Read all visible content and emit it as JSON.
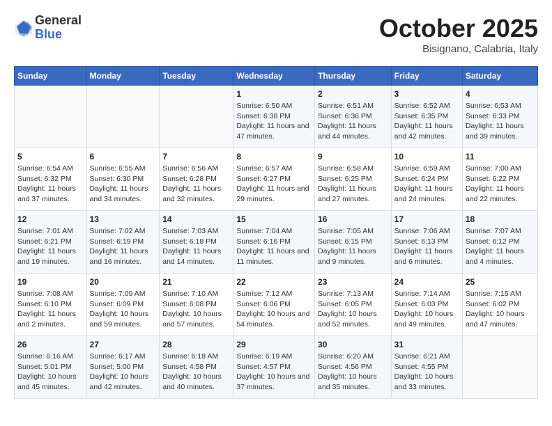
{
  "header": {
    "logo_general": "General",
    "logo_blue": "Blue",
    "month_title": "October 2025",
    "subtitle": "Bisignano, Calabria, Italy"
  },
  "calendar": {
    "days_of_week": [
      "Sunday",
      "Monday",
      "Tuesday",
      "Wednesday",
      "Thursday",
      "Friday",
      "Saturday"
    ],
    "weeks": [
      [
        {
          "day": "",
          "info": ""
        },
        {
          "day": "",
          "info": ""
        },
        {
          "day": "",
          "info": ""
        },
        {
          "day": "1",
          "info": "Sunrise: 6:50 AM\nSunset: 6:38 PM\nDaylight: 11 hours and 47 minutes."
        },
        {
          "day": "2",
          "info": "Sunrise: 6:51 AM\nSunset: 6:36 PM\nDaylight: 11 hours and 44 minutes."
        },
        {
          "day": "3",
          "info": "Sunrise: 6:52 AM\nSunset: 6:35 PM\nDaylight: 11 hours and 42 minutes."
        },
        {
          "day": "4",
          "info": "Sunrise: 6:53 AM\nSunset: 6:33 PM\nDaylight: 11 hours and 39 minutes."
        }
      ],
      [
        {
          "day": "5",
          "info": "Sunrise: 6:54 AM\nSunset: 6:32 PM\nDaylight: 11 hours and 37 minutes."
        },
        {
          "day": "6",
          "info": "Sunrise: 6:55 AM\nSunset: 6:30 PM\nDaylight: 11 hours and 34 minutes."
        },
        {
          "day": "7",
          "info": "Sunrise: 6:56 AM\nSunset: 6:28 PM\nDaylight: 11 hours and 32 minutes."
        },
        {
          "day": "8",
          "info": "Sunrise: 6:57 AM\nSunset: 6:27 PM\nDaylight: 11 hours and 29 minutes."
        },
        {
          "day": "9",
          "info": "Sunrise: 6:58 AM\nSunset: 6:25 PM\nDaylight: 11 hours and 27 minutes."
        },
        {
          "day": "10",
          "info": "Sunrise: 6:59 AM\nSunset: 6:24 PM\nDaylight: 11 hours and 24 minutes."
        },
        {
          "day": "11",
          "info": "Sunrise: 7:00 AM\nSunset: 6:22 PM\nDaylight: 11 hours and 22 minutes."
        }
      ],
      [
        {
          "day": "12",
          "info": "Sunrise: 7:01 AM\nSunset: 6:21 PM\nDaylight: 11 hours and 19 minutes."
        },
        {
          "day": "13",
          "info": "Sunrise: 7:02 AM\nSunset: 6:19 PM\nDaylight: 11 hours and 16 minutes."
        },
        {
          "day": "14",
          "info": "Sunrise: 7:03 AM\nSunset: 6:18 PM\nDaylight: 11 hours and 14 minutes."
        },
        {
          "day": "15",
          "info": "Sunrise: 7:04 AM\nSunset: 6:16 PM\nDaylight: 11 hours and 11 minutes."
        },
        {
          "day": "16",
          "info": "Sunrise: 7:05 AM\nSunset: 6:15 PM\nDaylight: 11 hours and 9 minutes."
        },
        {
          "day": "17",
          "info": "Sunrise: 7:06 AM\nSunset: 6:13 PM\nDaylight: 11 hours and 6 minutes."
        },
        {
          "day": "18",
          "info": "Sunrise: 7:07 AM\nSunset: 6:12 PM\nDaylight: 11 hours and 4 minutes."
        }
      ],
      [
        {
          "day": "19",
          "info": "Sunrise: 7:08 AM\nSunset: 6:10 PM\nDaylight: 11 hours and 2 minutes."
        },
        {
          "day": "20",
          "info": "Sunrise: 7:09 AM\nSunset: 6:09 PM\nDaylight: 10 hours and 59 minutes."
        },
        {
          "day": "21",
          "info": "Sunrise: 7:10 AM\nSunset: 6:08 PM\nDaylight: 10 hours and 57 minutes."
        },
        {
          "day": "22",
          "info": "Sunrise: 7:12 AM\nSunset: 6:06 PM\nDaylight: 10 hours and 54 minutes."
        },
        {
          "day": "23",
          "info": "Sunrise: 7:13 AM\nSunset: 6:05 PM\nDaylight: 10 hours and 52 minutes."
        },
        {
          "day": "24",
          "info": "Sunrise: 7:14 AM\nSunset: 6:03 PM\nDaylight: 10 hours and 49 minutes."
        },
        {
          "day": "25",
          "info": "Sunrise: 7:15 AM\nSunset: 6:02 PM\nDaylight: 10 hours and 47 minutes."
        }
      ],
      [
        {
          "day": "26",
          "info": "Sunrise: 6:16 AM\nSunset: 5:01 PM\nDaylight: 10 hours and 45 minutes."
        },
        {
          "day": "27",
          "info": "Sunrise: 6:17 AM\nSunset: 5:00 PM\nDaylight: 10 hours and 42 minutes."
        },
        {
          "day": "28",
          "info": "Sunrise: 6:18 AM\nSunset: 4:58 PM\nDaylight: 10 hours and 40 minutes."
        },
        {
          "day": "29",
          "info": "Sunrise: 6:19 AM\nSunset: 4:57 PM\nDaylight: 10 hours and 37 minutes."
        },
        {
          "day": "30",
          "info": "Sunrise: 6:20 AM\nSunset: 4:56 PM\nDaylight: 10 hours and 35 minutes."
        },
        {
          "day": "31",
          "info": "Sunrise: 6:21 AM\nSunset: 4:55 PM\nDaylight: 10 hours and 33 minutes."
        },
        {
          "day": "",
          "info": ""
        }
      ]
    ]
  }
}
